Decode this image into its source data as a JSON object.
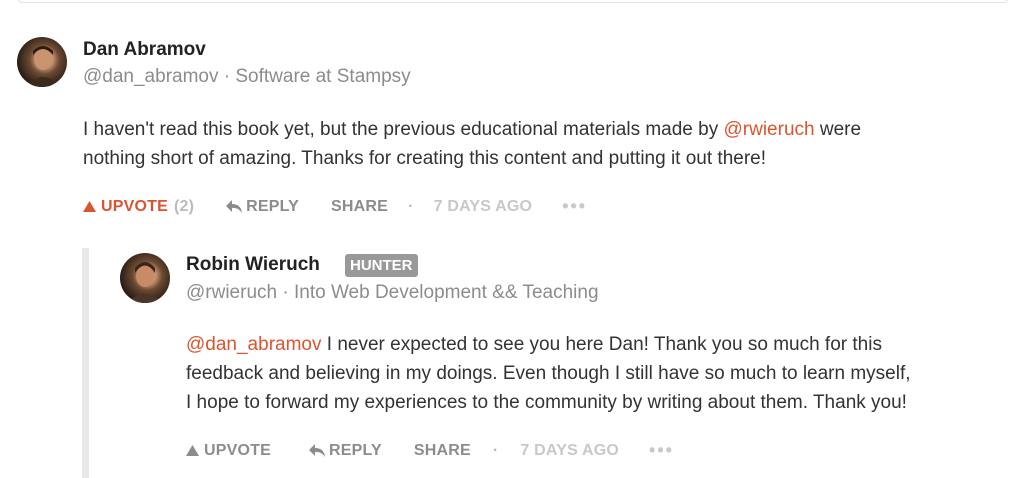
{
  "comment": {
    "author": "Dan Abramov",
    "handle_line": "@dan_abramov · Software at Stampsy",
    "text_before": "I haven't read this book yet, but the previous educational materials made by ",
    "mention": "@rwieruch",
    "text_after_1": " were",
    "text_line2": "nothing short of amazing. Thanks for creating this content and putting it out there!",
    "actions": {
      "upvote": "UPVOTE",
      "upvote_count": "(2)",
      "reply": "REPLY",
      "share": "SHARE",
      "separator": "·",
      "time": "7 DAYS AGO",
      "more": "•••"
    }
  },
  "reply": {
    "author": "Robin Wieruch",
    "badge": "HUNTER",
    "handle_line": "@rwieruch · Into Web Development && Teaching",
    "mention": "@dan_abramov",
    "line1_rest": " I never expected to see you here Dan! Thank you so much for this",
    "line2": "feedback and believing in my doings. Even though I still have so much to learn myself,",
    "line3": "I hope to forward my experiences to the community by writing about them. Thank you!",
    "actions": {
      "upvote": "UPVOTE",
      "reply": "REPLY",
      "share": "SHARE",
      "separator": "·",
      "time": "7 DAYS AGO",
      "more": "•••"
    }
  },
  "colors": {
    "accent": "#da552f",
    "badge_bg": "#999999",
    "meta": "#8c8c8c"
  }
}
